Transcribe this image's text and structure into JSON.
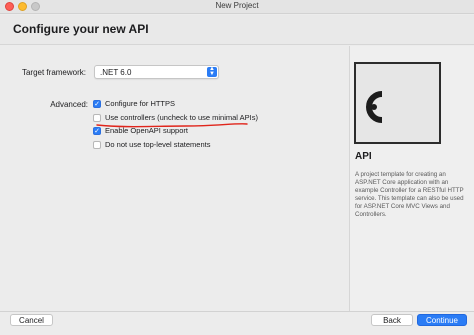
{
  "window": {
    "title": "New Project"
  },
  "header": {
    "title": "Configure your new API"
  },
  "form": {
    "target_framework_label": "Target framework:",
    "target_framework_value": ".NET 6.0",
    "advanced_label": "Advanced:",
    "options": [
      {
        "label": "Configure for HTTPS",
        "checked": true
      },
      {
        "label": "Use controllers (uncheck to use minimal APIs)",
        "checked": false
      },
      {
        "label": "Enable OpenAPI support",
        "checked": true
      },
      {
        "label": "Do not use top-level statements",
        "checked": false
      }
    ]
  },
  "template": {
    "title": "API",
    "description": "A project template for creating an ASP.NET Core application with an example Controller for a RESTful HTTP service. This template can also be used for ASP.NET Core MVC Views and Controllers.",
    "icon": "api-template-icon"
  },
  "footer": {
    "cancel_label": "Cancel",
    "back_label": "Back",
    "continue_label": "Continue"
  },
  "colors": {
    "accent": "#2a7cf5",
    "annotation": "#e0251b"
  }
}
